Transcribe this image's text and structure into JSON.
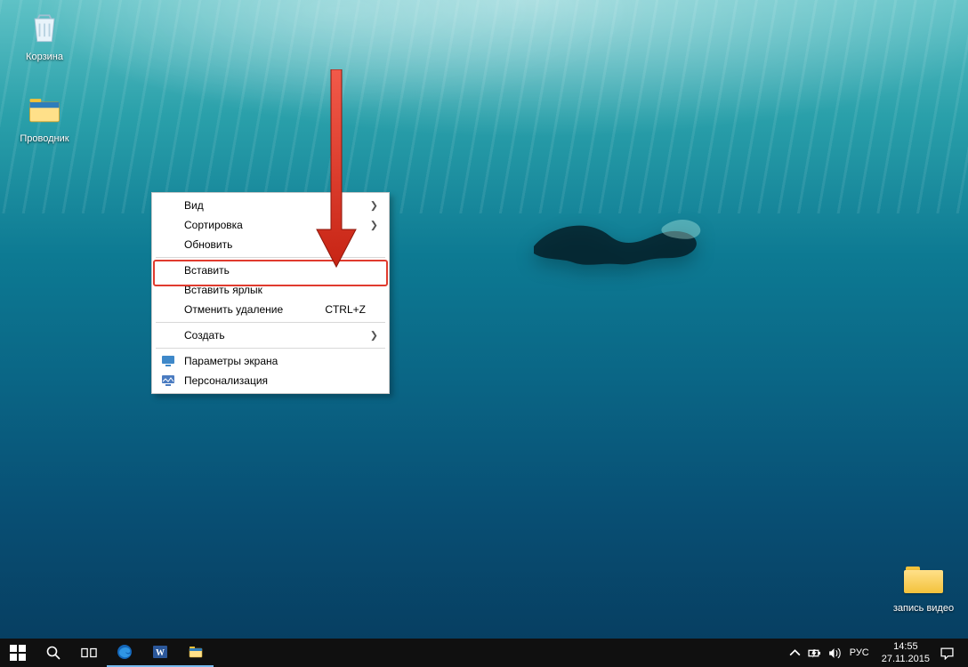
{
  "desktop_icons": {
    "recycle": "Корзина",
    "explorer": "Проводник",
    "folder1": "запись видео"
  },
  "context_menu": {
    "view": "Вид",
    "sort": "Сортировка",
    "refresh": "Обновить",
    "paste": "Вставить",
    "paste_shortcut": "Вставить ярлык",
    "undo_delete": "Отменить удаление",
    "undo_delete_kbd": "CTRL+Z",
    "create": "Создать",
    "display_settings": "Параметры экрана",
    "personalize": "Персонализация"
  },
  "taskbar": {
    "lang": "РУС"
  },
  "clock": {
    "time": "14:55",
    "date": "27.11.2015"
  }
}
